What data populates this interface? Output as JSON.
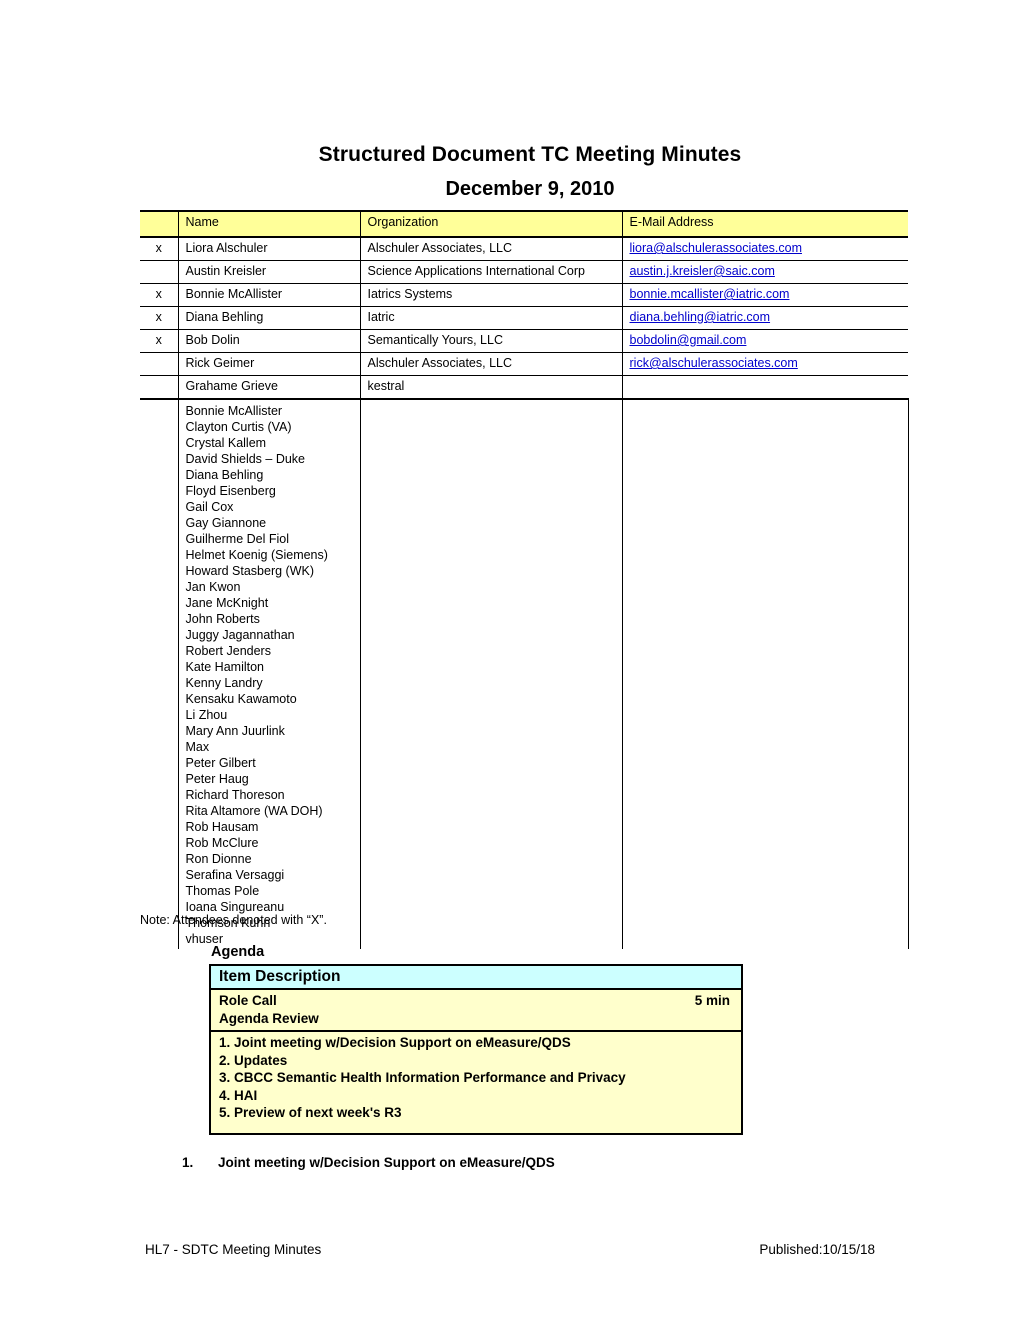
{
  "document": {
    "title": "Structured Document TC Meeting Minutes",
    "date": "December 9, 2010"
  },
  "attendee_table": {
    "headers": {
      "mark": "",
      "name": "Name",
      "organization": "Organization",
      "email": "E-Mail Address"
    },
    "rows": [
      {
        "mark": "x",
        "name": "Liora Alschuler",
        "organization": "Alschuler Associates, LLC",
        "email": "liora@alschulerassociates.com"
      },
      {
        "mark": "",
        "name": "Austin Kreisler",
        "organization": "Science Applications International Corp",
        "email": "austin.j.kreisler@saic.com"
      },
      {
        "mark": "x",
        "name": "Bonnie McAllister",
        "organization": "Iatrics Systems",
        "email": "bonnie.mcallister@iatric.com "
      },
      {
        "mark": "x",
        "name": "Diana Behling",
        "organization": "Iatric",
        "email": "diana.behling@iatric.com"
      },
      {
        "mark": "x",
        "name": "Bob Dolin",
        "organization": "Semantically Yours, LLC",
        "email": "bobdolin@gmail.com"
      },
      {
        "mark": "",
        "name": "Rick Geimer",
        "organization": "Alschuler Associates, LLC",
        "email": "rick@alschulerassociates.com"
      },
      {
        "mark": "",
        "name": "Grahame Grieve",
        "organization": "kestral",
        "email": ""
      }
    ],
    "participant_list": [
      "Bonnie McAllister",
      "Clayton Curtis (VA)",
      "Crystal Kallem",
      "David Shields – Duke",
      "Diana Behling",
      "Floyd Eisenberg",
      "Gail Cox",
      "Gay Giannone",
      "Guilherme Del Fiol",
      "Helmet Koenig (Siemens)",
      "Howard Stasberg (WK)",
      "Jan Kwon",
      "Jane McKnight",
      "John Roberts",
      "Juggy Jagannathan",
      "Robert Jenders",
      "Kate Hamilton",
      "Kenny Landry",
      "Kensaku Kawamoto",
      "Li Zhou",
      "Mary Ann Juurlink",
      "Max",
      "Peter Gilbert",
      "Peter Haug",
      "Richard Thoreson",
      "Rita Altamore (WA DOH)",
      "Rob Hausam",
      "Rob McClure",
      "Ron Dionne",
      "Serafina Versaggi",
      "Thomas Pole",
      "Ioana Singureanu",
      "Thomson Kuhn",
      "vhuser"
    ],
    "note": "Note: Attendees denoted with “X”."
  },
  "agenda": {
    "heading": "Agenda",
    "column_header": "Item  Description",
    "role_call": "Role Call",
    "agenda_review": "Agenda Review",
    "role_call_duration": "5 min",
    "items": [
      "1. Joint meeting w/Decision Support on eMeasure/QDS",
      "2. Updates",
      "3. CBCC Semantic Health Information Performance and Privacy",
      "4. HAI",
      "5. Preview of next week's R3"
    ]
  },
  "body": {
    "section_number": "1.",
    "section_title": "Joint meeting w/Decision Support on eMeasure/QDS"
  },
  "footer": {
    "left": "HL7 - SDTC Meeting Minutes",
    "right": "Published:10/15/18"
  },
  "colors": {
    "table_header_yellow": "#FFFF99",
    "agenda_header_cyan": "#CCFFFF",
    "agenda_body_yellow": "#FFFFCC",
    "link_blue": "#0000CC"
  }
}
